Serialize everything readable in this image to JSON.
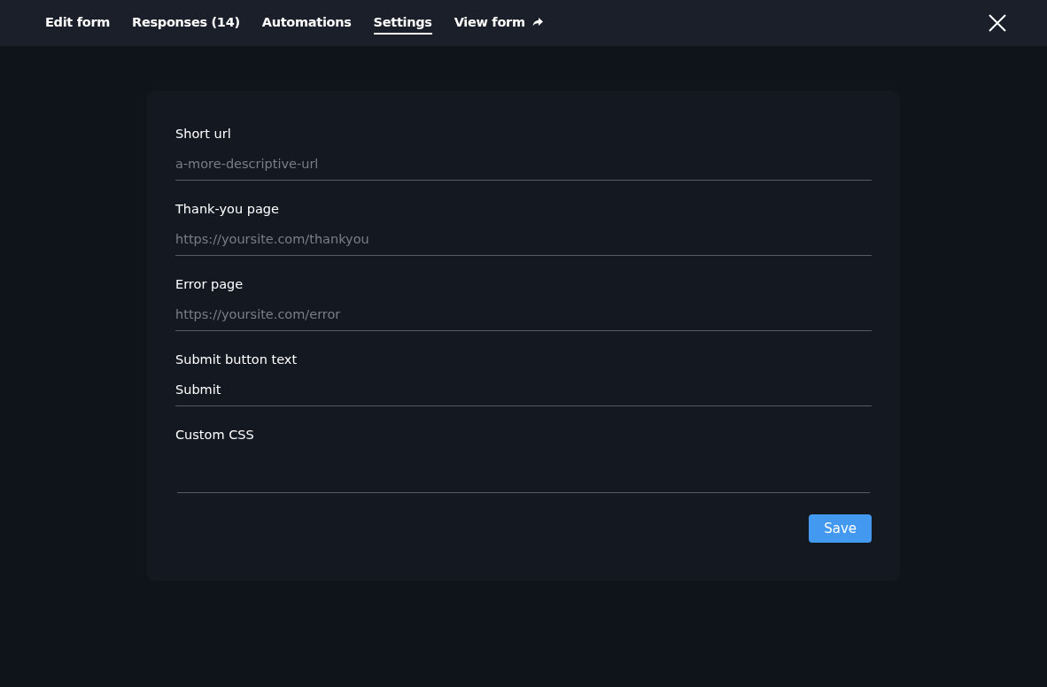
{
  "tabs": [
    {
      "label": "Edit form",
      "selected": false,
      "external": false
    },
    {
      "label": "Responses (14)",
      "selected": false,
      "external": false
    },
    {
      "label": "Automations",
      "selected": false,
      "external": false
    },
    {
      "label": "Settings",
      "selected": true,
      "external": false
    },
    {
      "label": "View form",
      "selected": false,
      "external": true
    }
  ],
  "fields": [
    {
      "kind": "text",
      "label": "Short url",
      "placeholder": "a-more-descriptive-url"
    },
    {
      "kind": "text",
      "label": "Thank-you page",
      "placeholder": "https://yoursite.com/thankyou"
    },
    {
      "kind": "text",
      "label": "Error page",
      "placeholder": "https://yoursite.com/error"
    },
    {
      "kind": "text",
      "label": "Submit button text",
      "value": "Submit"
    },
    {
      "kind": "textarea",
      "label": "Custom CSS"
    }
  ],
  "save_button": "Save"
}
